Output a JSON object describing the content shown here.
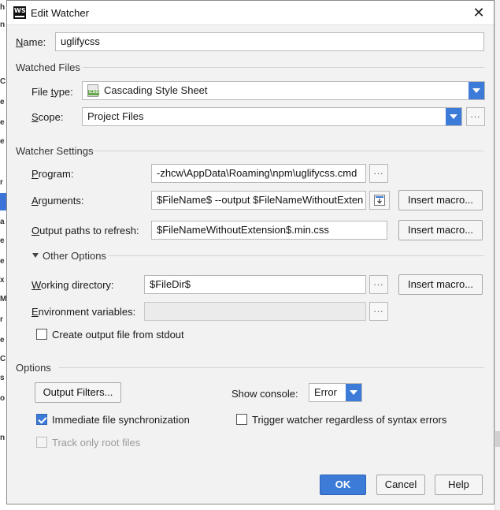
{
  "window": {
    "title": "Edit Watcher",
    "close_icon": "close-icon",
    "app_icon_text": "WS"
  },
  "name": {
    "label_u": "N",
    "label_rest": "ame:",
    "value": "uglifycss"
  },
  "watched_files": {
    "header": "Watched Files",
    "file_type": {
      "label_pre": "File ",
      "label_u": "t",
      "label_rest": "ype:",
      "value": "Cascading Style Sheet",
      "icon_text": "CSS"
    },
    "scope": {
      "label_u": "S",
      "label_rest": "cope:",
      "value": "Project Files",
      "more": "..."
    }
  },
  "watcher_settings": {
    "header": "Watcher Settings",
    "program": {
      "label_u": "P",
      "label_rest": "rogram:",
      "value": "-zhcw\\AppData\\Roaming\\npm\\uglifycss.cmd",
      "more": "..."
    },
    "arguments": {
      "label_u": "A",
      "label_rest": "rguments:",
      "value": "$FileName$ --output $FileNameWithoutExten",
      "insert_macro": "Insert macro..."
    },
    "output_paths": {
      "label_u": "O",
      "label_rest": "utput paths to refresh:",
      "value": "$FileNameWithoutExtension$.min.css",
      "insert_macro": "Insert macro..."
    },
    "other_options": "Other Options",
    "working_dir": {
      "label_u": "W",
      "label_rest": "orking directory:",
      "value": "$FileDir$",
      "more": "...",
      "insert_macro": "Insert macro..."
    },
    "env_vars": {
      "label_u": "E",
      "label_rest": "nvironment variables:",
      "value": "",
      "more": "..."
    },
    "create_output": {
      "label": "Create output file from stdout",
      "checked": false
    }
  },
  "options": {
    "header": "Options",
    "output_filters": "Output Filters...",
    "show_console": {
      "label": "Show console:",
      "value": "Error"
    },
    "immediate_sync": {
      "label": "Immediate file synchronization",
      "checked": true
    },
    "trigger_watcher": {
      "label": "Trigger watcher regardless of syntax errors",
      "checked": false
    },
    "track_root": {
      "label": "Track only root files",
      "checked": false,
      "enabled": false
    }
  },
  "footer": {
    "ok": "OK",
    "cancel": "Cancel",
    "help": "Help"
  },
  "colors": {
    "accent": "#3d7bd8",
    "dialog_bg": "#f2f2f2",
    "field_border": "#b8b8b8"
  }
}
